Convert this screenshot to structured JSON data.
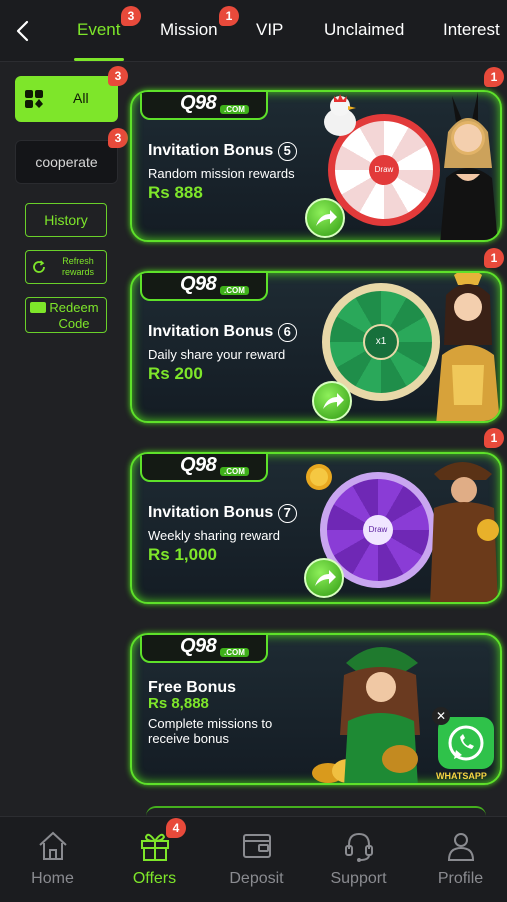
{
  "tabs": [
    {
      "label": "Event",
      "badge": "3",
      "active": true
    },
    {
      "label": "Mission",
      "badge": "1"
    },
    {
      "label": "VIP"
    },
    {
      "label": "Unclaimed"
    },
    {
      "label": "Interest"
    }
  ],
  "sidebar": {
    "all_label": "All",
    "all_badge": "3",
    "cooperate_label": "cooperate",
    "cooperate_badge": "3",
    "history_label": "History",
    "refresh_label": "Refresh rewards",
    "redeem_label": "Redeem Code"
  },
  "banners": [
    {
      "logo": "Q98",
      "logo_sub": ".COM",
      "title": "Invitation Bonus",
      "num": "5",
      "subtitle": "Random mission rewards",
      "amount": "Rs 888",
      "badge": "1",
      "wheel_center": "Draw"
    },
    {
      "logo": "Q98",
      "logo_sub": ".COM",
      "title": "Invitation Bonus",
      "num": "6",
      "subtitle": "Daily share your reward",
      "amount": "Rs 200",
      "badge": "1",
      "wheel_center": "x1"
    },
    {
      "logo": "Q98",
      "logo_sub": ".COM",
      "title": "Invitation Bonus",
      "num": "7",
      "subtitle": "Weekly sharing reward",
      "amount": "Rs 1,000",
      "badge": "1",
      "wheel_center": "Draw"
    },
    {
      "logo": "Q98",
      "logo_sub": ".COM",
      "title": "Free Bonus",
      "amount": "Rs 8,888",
      "subtitle": "Complete missions to",
      "subtitle2": "receive bonus",
      "whatsapp": "WHATSAPP"
    }
  ],
  "bottom_nav": [
    {
      "label": "Home",
      "icon": "home-icon"
    },
    {
      "label": "Offers",
      "icon": "gift-icon",
      "badge": "4",
      "active": true
    },
    {
      "label": "Deposit",
      "icon": "wallet-icon"
    },
    {
      "label": "Support",
      "icon": "headset-icon"
    },
    {
      "label": "Profile",
      "icon": "user-icon"
    }
  ],
  "colors": {
    "accent": "#7ee62a",
    "badge": "#e84a3b",
    "background": "#202124"
  }
}
